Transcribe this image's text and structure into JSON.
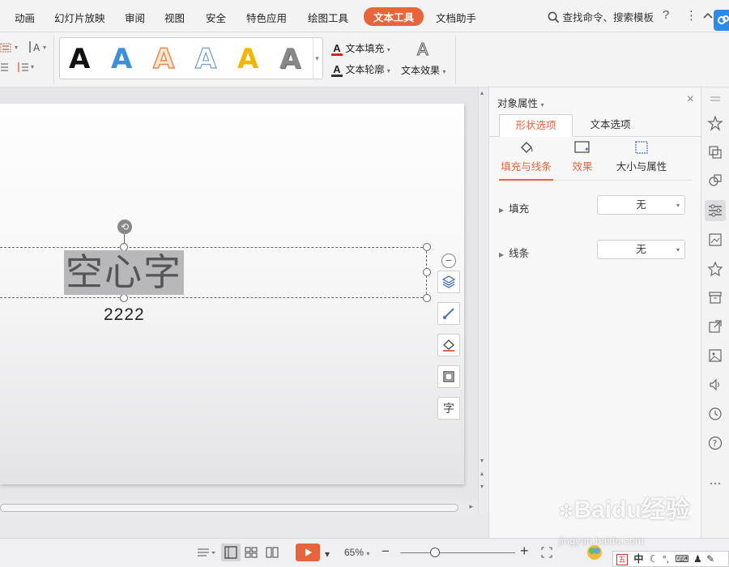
{
  "menu": {
    "items": [
      "动画",
      "幻灯片放映",
      "审阅",
      "视图",
      "安全",
      "特色应用",
      "绘图工具",
      "文本工具",
      "文档助手"
    ],
    "active": "文本工具",
    "search_label": "查找命令、搜索模板",
    "help_label": "?",
    "more_label": "⋮"
  },
  "ribbon": {
    "style_letter": "A",
    "style_colors": [
      "#111111",
      "#3d8fd8",
      "#e88a4a",
      "#8ab0e0",
      "#f2b705",
      "#777777"
    ],
    "text_fill_label": "文本填充",
    "text_outline_label": "文本轮廓",
    "text_effect_label": "文本效果"
  },
  "slide": {
    "main_text": "空心字",
    "sub_text": "2222"
  },
  "float_tools": {
    "minus": "−",
    "text_tool_glyph": "字"
  },
  "panel": {
    "title": "对象属性",
    "tabs": [
      "形状选项",
      "文本选项"
    ],
    "active_tab": "形状选项",
    "subtabs": [
      "填充与线条",
      "效果",
      "大小与属性"
    ],
    "active_subtab": "填充与线条",
    "props": [
      {
        "label": "填充",
        "value": "无"
      },
      {
        "label": "线条",
        "value": "无"
      }
    ]
  },
  "status": {
    "zoom": "65%",
    "minus": "−",
    "plus": "+"
  },
  "ime": {
    "text": "中"
  },
  "watermark": {
    "brand": "Baidu经验",
    "url": "jingyan.baidu.com"
  },
  "colors": {
    "accent": "#e8643c",
    "panel_bg": "#f7f7f8"
  }
}
